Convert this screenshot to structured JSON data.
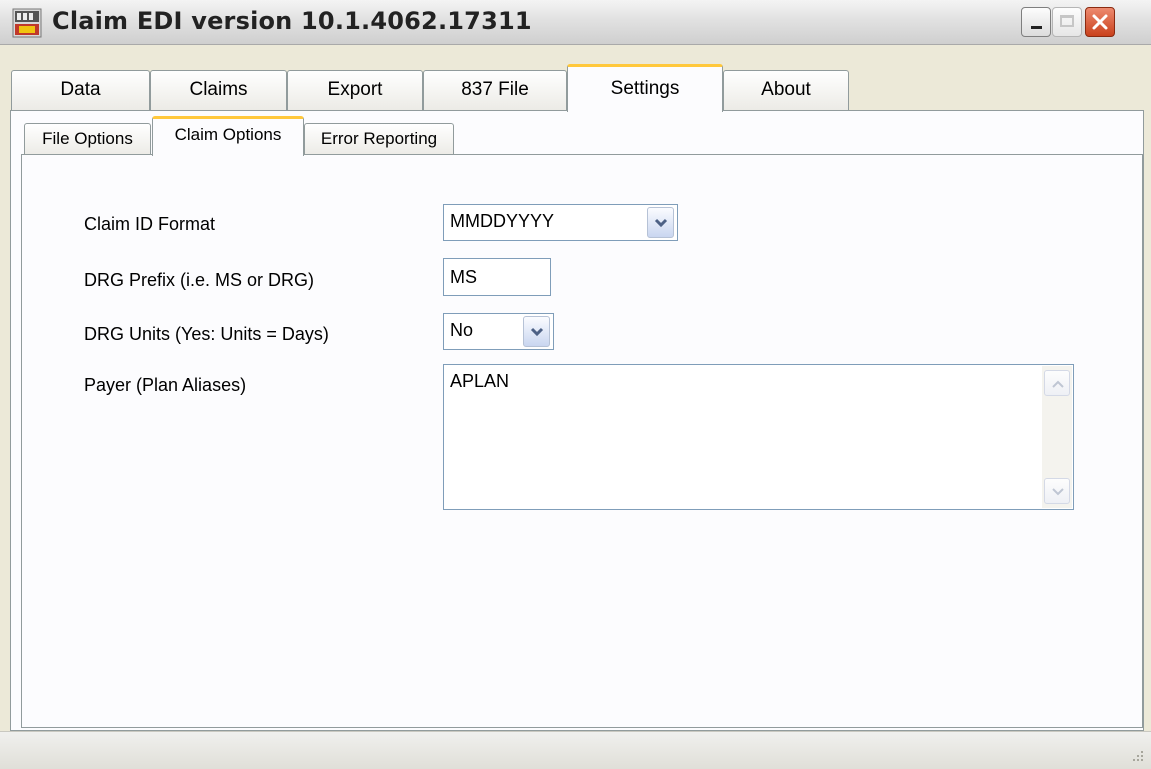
{
  "window": {
    "title": "Claim EDI version 10.1.4062.17311"
  },
  "main_tabs": [
    {
      "label": "Data"
    },
    {
      "label": "Claims"
    },
    {
      "label": "Export"
    },
    {
      "label": "837 File"
    },
    {
      "label": "Settings"
    },
    {
      "label": "About"
    }
  ],
  "main_tabs_active": "Settings",
  "sub_tabs": [
    {
      "label": "File Options"
    },
    {
      "label": "Claim Options"
    },
    {
      "label": "Error Reporting"
    }
  ],
  "sub_tabs_active": "Claim Options",
  "form": {
    "claim_id_format": {
      "label": "Claim ID Format",
      "value": "MMDDYYYY"
    },
    "drg_prefix": {
      "label": "DRG Prefix (i.e. MS or DRG)",
      "value": "MS"
    },
    "drg_units": {
      "label": "DRG Units (Yes: Units = Days)",
      "value": "No"
    },
    "payer": {
      "label": "Payer (Plan Aliases)",
      "value": "APLAN"
    }
  },
  "colors": {
    "tab_active_accent": "#ffc83c",
    "panel_border": "#919b9c",
    "field_border": "#7f9db9",
    "close_button": "#c9411c"
  },
  "icons": [
    "app-icon",
    "minimize-icon",
    "maximize-icon",
    "close-icon",
    "chevron-down-icon",
    "scroll-up-icon",
    "scroll-down-icon",
    "resize-grip-icon"
  ]
}
